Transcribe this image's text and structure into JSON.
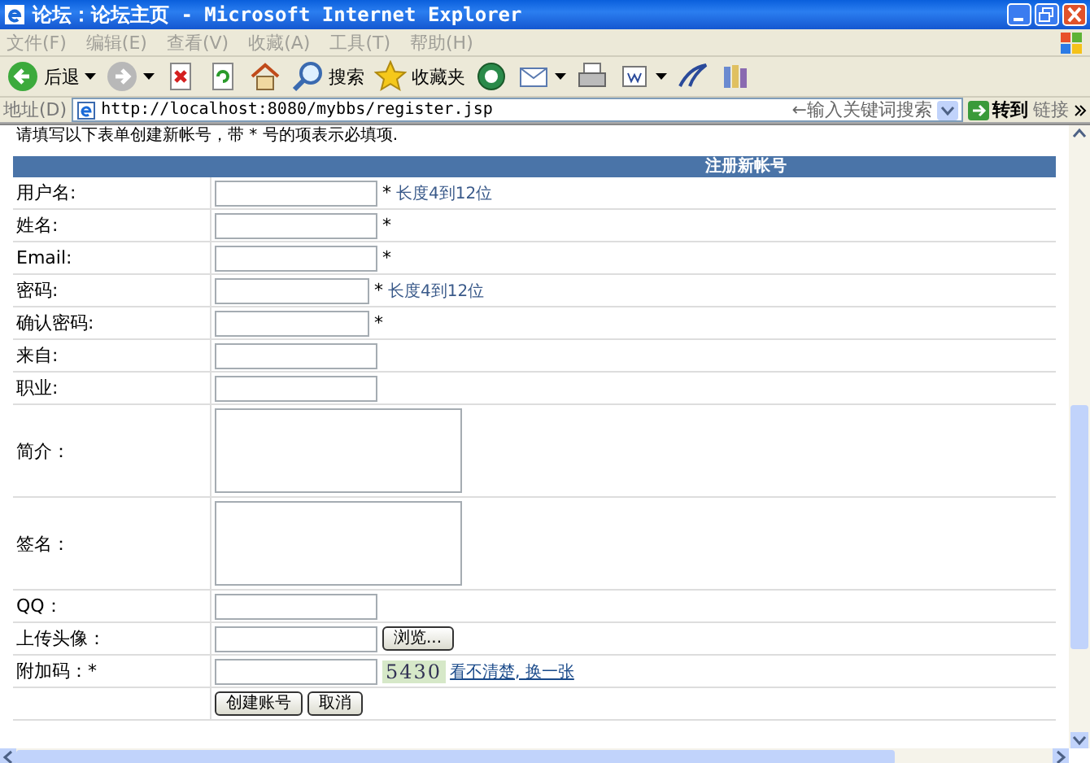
{
  "window": {
    "title": "论坛：论坛主页 - Microsoft Internet Explorer"
  },
  "menu": [
    "文件(F)",
    "编辑(E)",
    "查看(V)",
    "收藏(A)",
    "工具(T)",
    "帮助(H)"
  ],
  "toolbar": [
    {
      "kind": "back",
      "label": "后退",
      "dropdown": true
    },
    {
      "kind": "forward",
      "dropdown": true
    },
    {
      "kind": "stop",
      "dropdown": false
    },
    {
      "kind": "refresh",
      "dropdown": false
    },
    {
      "kind": "home",
      "dropdown": false
    },
    {
      "kind": "search",
      "label": "搜索",
      "dropdown": false
    },
    {
      "kind": "favorites",
      "label": "收藏夹",
      "dropdown": false
    },
    {
      "kind": "media",
      "dropdown": false
    },
    {
      "kind": "mail",
      "dropdown": true
    },
    {
      "kind": "print",
      "dropdown": false
    },
    {
      "kind": "edit",
      "dropdown": true
    },
    {
      "kind": "messenger",
      "dropdown": false
    },
    {
      "kind": "research",
      "dropdown": false
    }
  ],
  "address": {
    "label": "地址(D)",
    "url": "http://localhost:8080/mybbs/register.jsp",
    "search_placeholder": "←输入关键词搜索",
    "go": "转到",
    "links": "链接"
  },
  "intro": "请填写以下表单创建新帐号，带 * 号的项表示必填项.",
  "form": {
    "title": "注册新帐号",
    "rows": [
      {
        "kind": "text",
        "label": "用户名:",
        "required": "*",
        "hint": "长度4到12位"
      },
      {
        "kind": "text",
        "label": "姓名:",
        "required": "*"
      },
      {
        "kind": "text",
        "label": "Email:",
        "required": "*"
      },
      {
        "kind": "password",
        "label": "密码:",
        "required": "*",
        "hint": "长度4到12位"
      },
      {
        "kind": "password",
        "label": "确认密码:",
        "required": "*"
      },
      {
        "kind": "text",
        "label": "来自:"
      },
      {
        "kind": "text",
        "label": "职业:"
      },
      {
        "kind": "textarea",
        "label": "简介："
      },
      {
        "kind": "textarea",
        "label": "签名："
      },
      {
        "kind": "text",
        "label": "QQ："
      },
      {
        "kind": "file",
        "label": "上传头像：",
        "button": "浏览..."
      },
      {
        "kind": "captcha",
        "label": "附加码：*",
        "code": "5430",
        "link": "看不清楚, 换一张"
      },
      {
        "kind": "buttons",
        "buttons": [
          "创建账号",
          "取消"
        ]
      }
    ]
  }
}
